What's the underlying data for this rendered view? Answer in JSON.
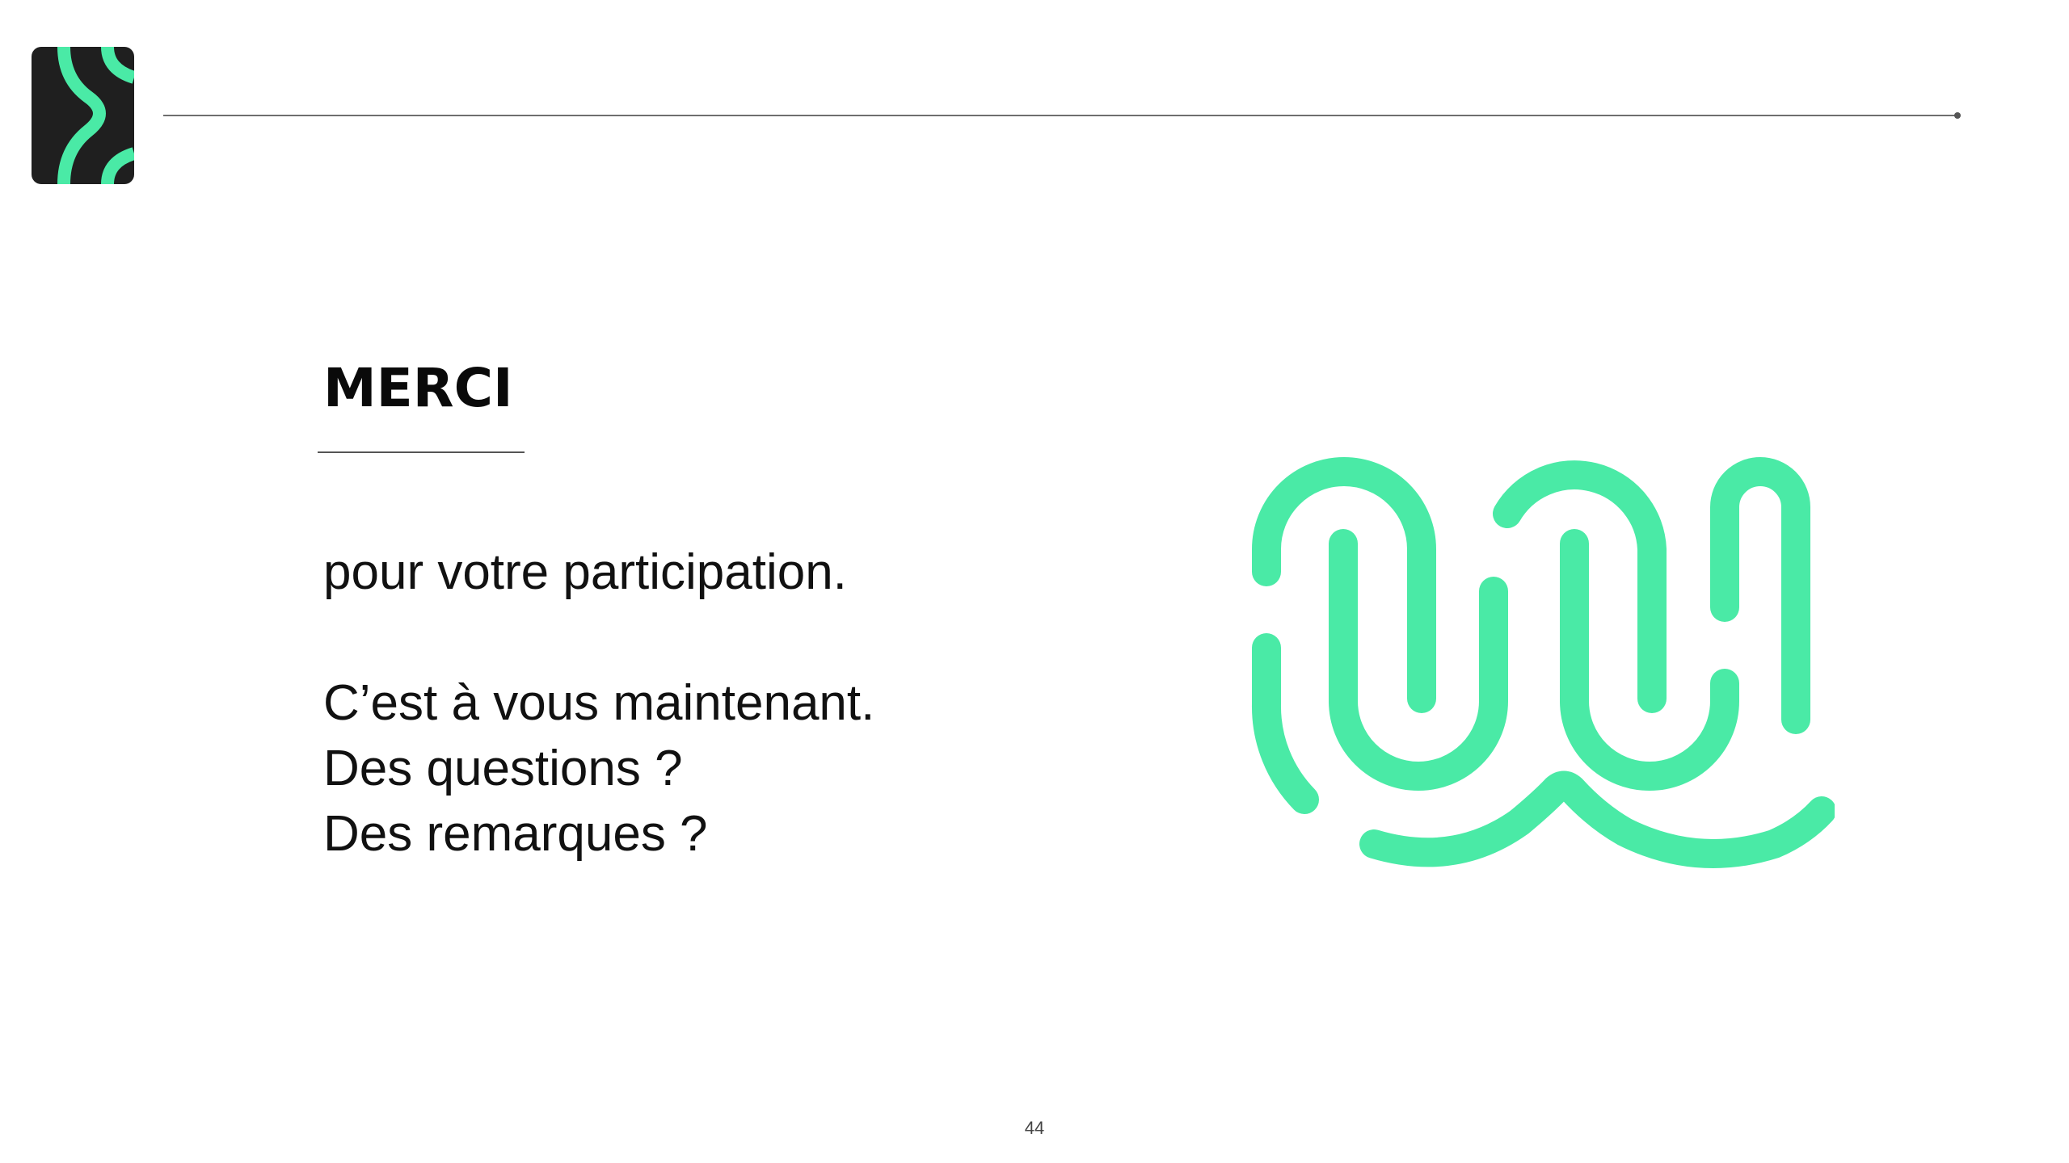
{
  "slide": {
    "title": "MERCI",
    "body": {
      "line1": "pour votre participation.",
      "line2": "C’est à vous maintenant.",
      "line3": "Des questions ?",
      "line4": "Des remarques ?"
    },
    "page_number": "44"
  },
  "colors": {
    "accent": "#4aeaa6",
    "logo_background": "#1f1f1f",
    "text": "#111111",
    "rule": "#6e6e6e"
  },
  "icons": {
    "logo": "brand-logo-icon",
    "graphic": "wave-pattern-graphic"
  }
}
